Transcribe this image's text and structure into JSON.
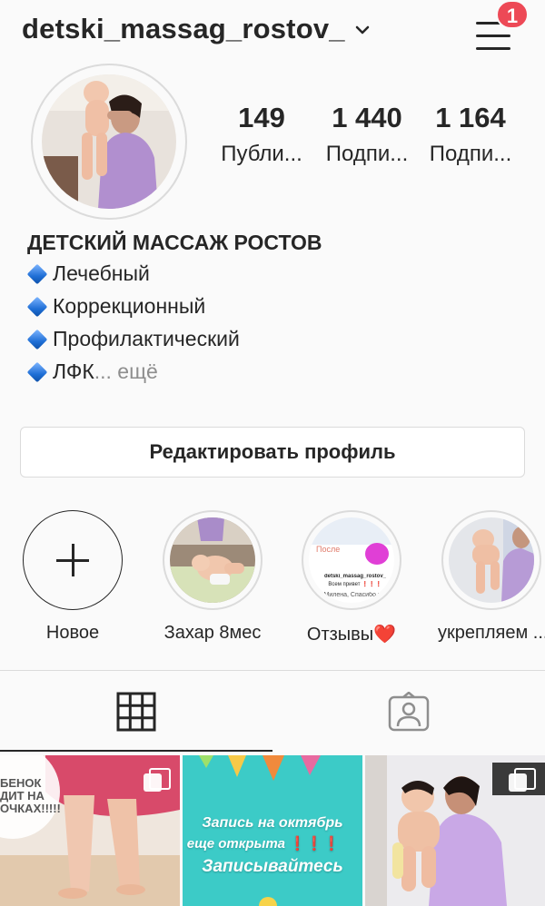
{
  "header": {
    "username": "detski_massag_rostov_",
    "menu_badge": "1"
  },
  "profile": {
    "stats": [
      {
        "value": "149",
        "label": "Публи..."
      },
      {
        "value": "1 440",
        "label": "Подпи..."
      },
      {
        "value": "1 164",
        "label": "Подпи..."
      }
    ],
    "name": "ДЕТСКИЙ МАССАЖ РОСТОВ",
    "bio_lines": [
      "Лечебный",
      "Коррекционный",
      "Профилактический",
      "ЛФК"
    ],
    "bio_more": "... ещё",
    "edit_button": "Редактировать профиль"
  },
  "highlights": [
    {
      "label": "Новое",
      "icon": "plus-icon"
    },
    {
      "label": "Захар 8мес"
    },
    {
      "label": "Отзывы❤️"
    },
    {
      "label": "укрепляем ..."
    }
  ],
  "highlight_review": {
    "after_label": "После",
    "account": "detski_massag_rostov_",
    "greeting": "Всем привет ❗❗❗",
    "text": "Милена, Спасибо в..."
  },
  "tabs": [
    {
      "name": "grid",
      "icon": "grid-icon",
      "active": true
    },
    {
      "name": "tagged",
      "icon": "tagged-person-icon",
      "active": false
    }
  ],
  "posts": [
    {
      "text": "БЕНОК ДИТ НА ОЧКАХ!!!!!"
    },
    {
      "text_lines": [
        "Запись на октябрь",
        "еще открыта",
        "Записывайтесь"
      ],
      "exclaim": "❗❗❗"
    },
    {
      "text": ""
    }
  ],
  "colors": {
    "badge": "#ed4956",
    "border": "#dbdbdb",
    "text": "#262626",
    "muted": "#8e8e8e"
  }
}
